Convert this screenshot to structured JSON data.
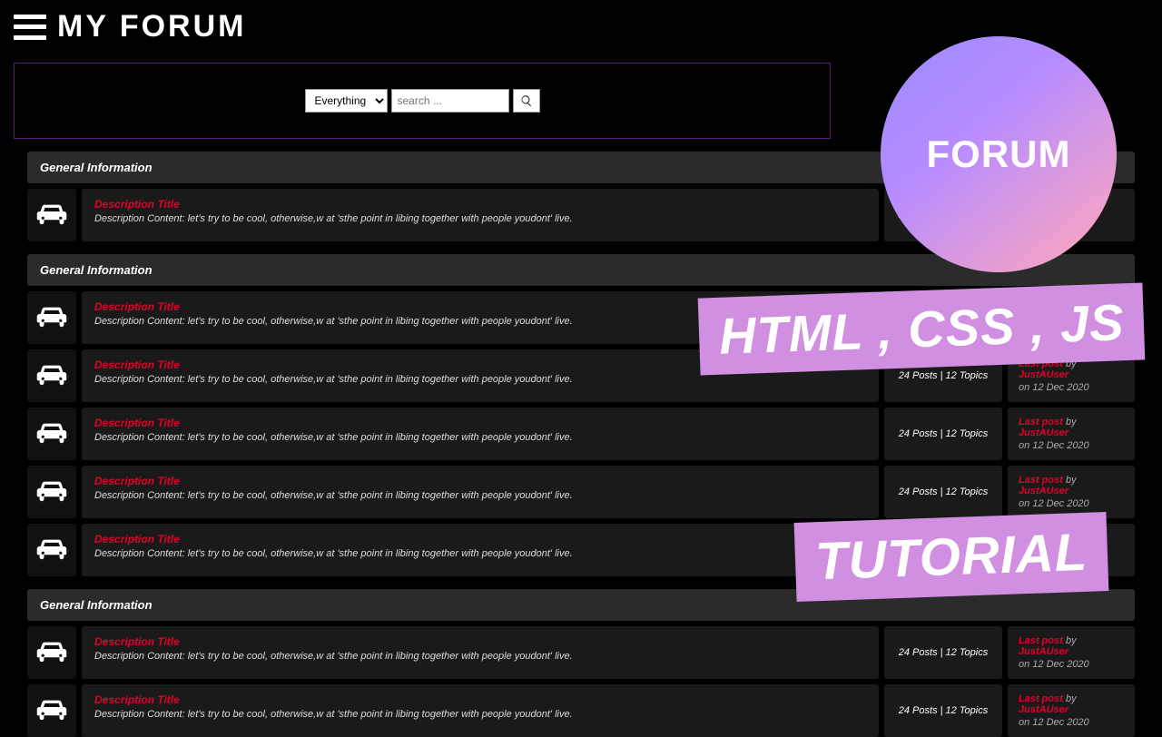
{
  "header": {
    "site_title": "MY FORUM"
  },
  "search": {
    "select_value": "Everything",
    "placeholder": "search ..."
  },
  "desc_title": "Description Title",
  "desc_text": "Description Content: let's try to be cool, otherwise,w at 'sthe point in libing together with people youdont' live.",
  "stats": "24 Posts | 12 Topics",
  "last": {
    "label": "Last post",
    "by": "by",
    "user": "JustAUser",
    "date": "on 12 Dec 2020"
  },
  "section_title": "General Information",
  "overlay": {
    "circle": "FORUM",
    "l1": "HTML , CSS , JS",
    "l2": "TUTORIAL"
  }
}
